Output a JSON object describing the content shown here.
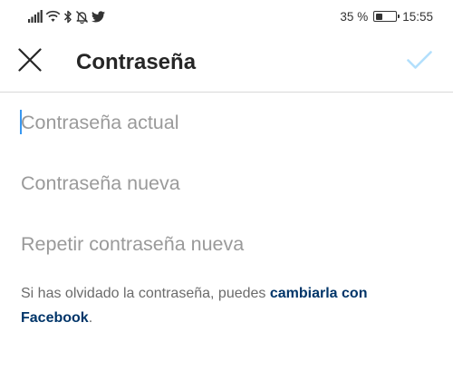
{
  "status_bar": {
    "battery_percent": "35 %",
    "battery_level": 0.35,
    "time": "15:55",
    "icons": [
      "signal-icon",
      "wifi-icon",
      "bluetooth-icon",
      "mute-icon",
      "twitter-icon"
    ]
  },
  "header": {
    "title": "Contraseña",
    "close_icon": "close-icon",
    "confirm_icon": "checkmark-icon"
  },
  "form": {
    "current_password": {
      "placeholder": "Contraseña actual",
      "value": ""
    },
    "new_password": {
      "placeholder": "Contraseña nueva",
      "value": ""
    },
    "repeat_password": {
      "placeholder": "Repetir contraseña nueva",
      "value": ""
    }
  },
  "help": {
    "prefix": "Si has olvidado la contraseña, puedes ",
    "link": "cambiarla con Facebook",
    "suffix": "."
  },
  "colors": {
    "accent": "#3897f0",
    "confirm_disabled": "#b2dffc",
    "link": "#003569",
    "placeholder": "#9a9a9a",
    "divider": "#d9d9d9"
  }
}
